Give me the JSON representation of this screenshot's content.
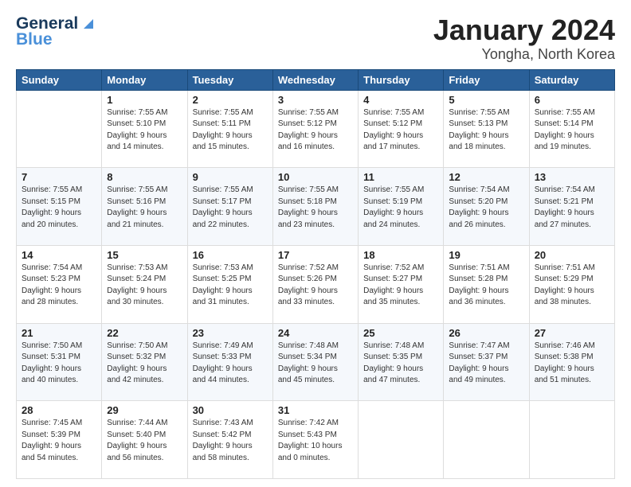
{
  "header": {
    "logo_line1": "General",
    "logo_line2": "Blue",
    "month": "January 2024",
    "location": "Yongha, North Korea"
  },
  "weekdays": [
    "Sunday",
    "Monday",
    "Tuesday",
    "Wednesday",
    "Thursday",
    "Friday",
    "Saturday"
  ],
  "weeks": [
    [
      {
        "day": "",
        "text": ""
      },
      {
        "day": "1",
        "text": "Sunrise: 7:55 AM\nSunset: 5:10 PM\nDaylight: 9 hours\nand 14 minutes."
      },
      {
        "day": "2",
        "text": "Sunrise: 7:55 AM\nSunset: 5:11 PM\nDaylight: 9 hours\nand 15 minutes."
      },
      {
        "day": "3",
        "text": "Sunrise: 7:55 AM\nSunset: 5:12 PM\nDaylight: 9 hours\nand 16 minutes."
      },
      {
        "day": "4",
        "text": "Sunrise: 7:55 AM\nSunset: 5:12 PM\nDaylight: 9 hours\nand 17 minutes."
      },
      {
        "day": "5",
        "text": "Sunrise: 7:55 AM\nSunset: 5:13 PM\nDaylight: 9 hours\nand 18 minutes."
      },
      {
        "day": "6",
        "text": "Sunrise: 7:55 AM\nSunset: 5:14 PM\nDaylight: 9 hours\nand 19 minutes."
      }
    ],
    [
      {
        "day": "7",
        "text": "Sunrise: 7:55 AM\nSunset: 5:15 PM\nDaylight: 9 hours\nand 20 minutes."
      },
      {
        "day": "8",
        "text": "Sunrise: 7:55 AM\nSunset: 5:16 PM\nDaylight: 9 hours\nand 21 minutes."
      },
      {
        "day": "9",
        "text": "Sunrise: 7:55 AM\nSunset: 5:17 PM\nDaylight: 9 hours\nand 22 minutes."
      },
      {
        "day": "10",
        "text": "Sunrise: 7:55 AM\nSunset: 5:18 PM\nDaylight: 9 hours\nand 23 minutes."
      },
      {
        "day": "11",
        "text": "Sunrise: 7:55 AM\nSunset: 5:19 PM\nDaylight: 9 hours\nand 24 minutes."
      },
      {
        "day": "12",
        "text": "Sunrise: 7:54 AM\nSunset: 5:20 PM\nDaylight: 9 hours\nand 26 minutes."
      },
      {
        "day": "13",
        "text": "Sunrise: 7:54 AM\nSunset: 5:21 PM\nDaylight: 9 hours\nand 27 minutes."
      }
    ],
    [
      {
        "day": "14",
        "text": "Sunrise: 7:54 AM\nSunset: 5:23 PM\nDaylight: 9 hours\nand 28 minutes."
      },
      {
        "day": "15",
        "text": "Sunrise: 7:53 AM\nSunset: 5:24 PM\nDaylight: 9 hours\nand 30 minutes."
      },
      {
        "day": "16",
        "text": "Sunrise: 7:53 AM\nSunset: 5:25 PM\nDaylight: 9 hours\nand 31 minutes."
      },
      {
        "day": "17",
        "text": "Sunrise: 7:52 AM\nSunset: 5:26 PM\nDaylight: 9 hours\nand 33 minutes."
      },
      {
        "day": "18",
        "text": "Sunrise: 7:52 AM\nSunset: 5:27 PM\nDaylight: 9 hours\nand 35 minutes."
      },
      {
        "day": "19",
        "text": "Sunrise: 7:51 AM\nSunset: 5:28 PM\nDaylight: 9 hours\nand 36 minutes."
      },
      {
        "day": "20",
        "text": "Sunrise: 7:51 AM\nSunset: 5:29 PM\nDaylight: 9 hours\nand 38 minutes."
      }
    ],
    [
      {
        "day": "21",
        "text": "Sunrise: 7:50 AM\nSunset: 5:31 PM\nDaylight: 9 hours\nand 40 minutes."
      },
      {
        "day": "22",
        "text": "Sunrise: 7:50 AM\nSunset: 5:32 PM\nDaylight: 9 hours\nand 42 minutes."
      },
      {
        "day": "23",
        "text": "Sunrise: 7:49 AM\nSunset: 5:33 PM\nDaylight: 9 hours\nand 44 minutes."
      },
      {
        "day": "24",
        "text": "Sunrise: 7:48 AM\nSunset: 5:34 PM\nDaylight: 9 hours\nand 45 minutes."
      },
      {
        "day": "25",
        "text": "Sunrise: 7:48 AM\nSunset: 5:35 PM\nDaylight: 9 hours\nand 47 minutes."
      },
      {
        "day": "26",
        "text": "Sunrise: 7:47 AM\nSunset: 5:37 PM\nDaylight: 9 hours\nand 49 minutes."
      },
      {
        "day": "27",
        "text": "Sunrise: 7:46 AM\nSunset: 5:38 PM\nDaylight: 9 hours\nand 51 minutes."
      }
    ],
    [
      {
        "day": "28",
        "text": "Sunrise: 7:45 AM\nSunset: 5:39 PM\nDaylight: 9 hours\nand 54 minutes."
      },
      {
        "day": "29",
        "text": "Sunrise: 7:44 AM\nSunset: 5:40 PM\nDaylight: 9 hours\nand 56 minutes."
      },
      {
        "day": "30",
        "text": "Sunrise: 7:43 AM\nSunset: 5:42 PM\nDaylight: 9 hours\nand 58 minutes."
      },
      {
        "day": "31",
        "text": "Sunrise: 7:42 AM\nSunset: 5:43 PM\nDaylight: 10 hours\nand 0 minutes."
      },
      {
        "day": "",
        "text": ""
      },
      {
        "day": "",
        "text": ""
      },
      {
        "day": "",
        "text": ""
      }
    ]
  ]
}
